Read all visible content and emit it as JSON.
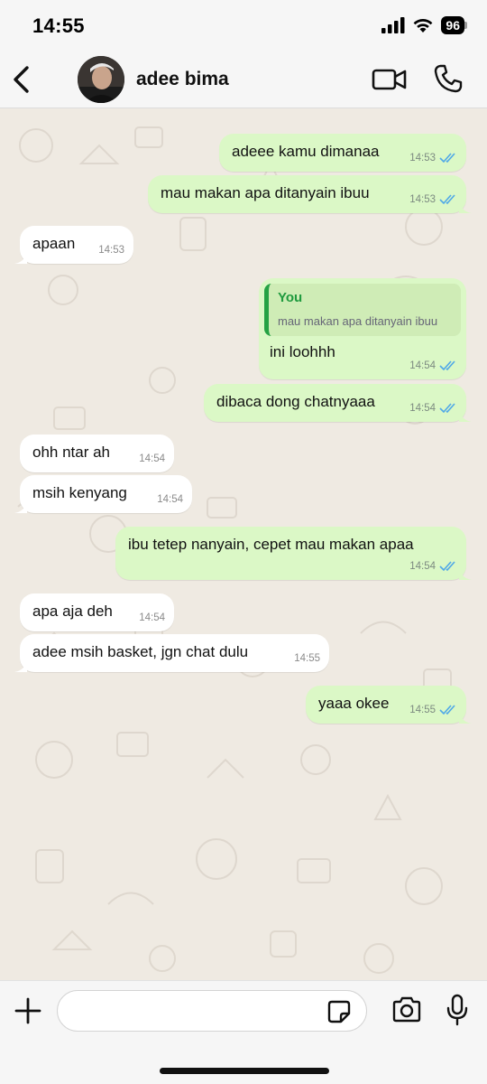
{
  "status_bar": {
    "time": "14:55",
    "battery": "96",
    "icons": [
      "signal-icon",
      "wifi-icon",
      "battery-icon"
    ]
  },
  "header": {
    "contact_name": "adee bima",
    "icons": [
      "back-icon",
      "video-call-icon",
      "phone-icon"
    ]
  },
  "messages": [
    {
      "dir": "out",
      "text": "adeee kamu dimanaa",
      "time": "14:53",
      "read": true
    },
    {
      "dir": "out",
      "text": "mau makan apa ditanyain ibuu",
      "time": "14:53",
      "read": true
    },
    {
      "dir": "in",
      "text": "apaan",
      "time": "14:53"
    },
    {
      "dir": "out",
      "text": "ini loohhh",
      "time": "14:54",
      "read": true,
      "reply": {
        "author": "You",
        "text": "mau makan apa ditanyain ibuu"
      }
    },
    {
      "dir": "out",
      "text": "dibaca dong chatnyaaa",
      "time": "14:54",
      "read": true
    },
    {
      "dir": "in",
      "text": "ohh ntar ah",
      "time": "14:54"
    },
    {
      "dir": "in",
      "text": "msih kenyang",
      "time": "14:54"
    },
    {
      "dir": "out",
      "text": "ibu tetep nanyain, cepet mau makan apaa",
      "time": "14:54",
      "read": true
    },
    {
      "dir": "in",
      "text": "apa aja deh",
      "time": "14:54"
    },
    {
      "dir": "in",
      "text": "adee msih basket, jgn chat dulu",
      "time": "14:55"
    },
    {
      "dir": "out",
      "text": "yaaa okee",
      "time": "14:55",
      "read": true
    }
  ],
  "input_bar": {
    "placeholder": "",
    "icons": [
      "plus-icon",
      "sticker-icon",
      "camera-icon",
      "microphone-icon"
    ]
  },
  "colors": {
    "outgoing_bubble": "#dbf8c6",
    "incoming_bubble": "#ffffff",
    "chat_bg": "#efeae2",
    "read_ticks": "#4fa8e8",
    "reply_accent": "#25a244"
  }
}
